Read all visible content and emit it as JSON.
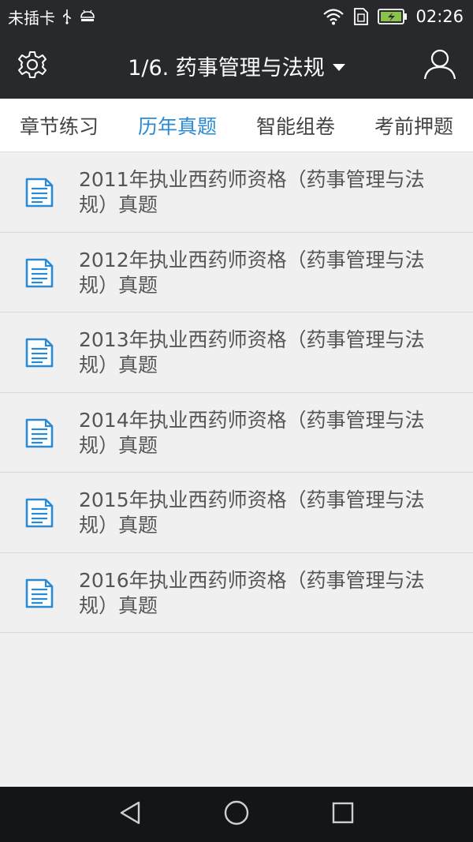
{
  "status_bar": {
    "carrier": "未插卡",
    "time": "02:26",
    "icons": [
      "usb-icon",
      "android-debug-icon",
      "wifi-icon",
      "sim-icon",
      "battery-charging-icon"
    ]
  },
  "header": {
    "title": "1/6. 药事管理与法规",
    "settings_icon": "gear-icon",
    "profile_icon": "user-icon"
  },
  "tabs": [
    {
      "label": "章节练习",
      "active": false
    },
    {
      "label": "历年真题",
      "active": true
    },
    {
      "label": "智能组卷",
      "active": false
    },
    {
      "label": "考前押题",
      "active": false
    }
  ],
  "papers": [
    {
      "title": "2011年执业西药师资格（药事管理与法规）真题",
      "icon": "document-icon"
    },
    {
      "title": "2012年执业西药师资格（药事管理与法规）真题",
      "icon": "document-icon"
    },
    {
      "title": "2013年执业西药师资格（药事管理与法规）真题",
      "icon": "document-icon"
    },
    {
      "title": "2014年执业西药师资格（药事管理与法规）真题",
      "icon": "document-icon"
    },
    {
      "title": "2015年执业西药师资格（药事管理与法规）真题",
      "icon": "document-icon"
    },
    {
      "title": "2016年执业西药师资格（药事管理与法规）真题",
      "icon": "document-icon"
    }
  ],
  "nav_bar": {
    "buttons": [
      "back-icon",
      "home-icon",
      "recents-icon"
    ]
  },
  "colors": {
    "header_bg": "#27292c",
    "accent": "#2a8ad4",
    "list_bg": "#f0f0f0",
    "nav_bg": "#141517"
  }
}
